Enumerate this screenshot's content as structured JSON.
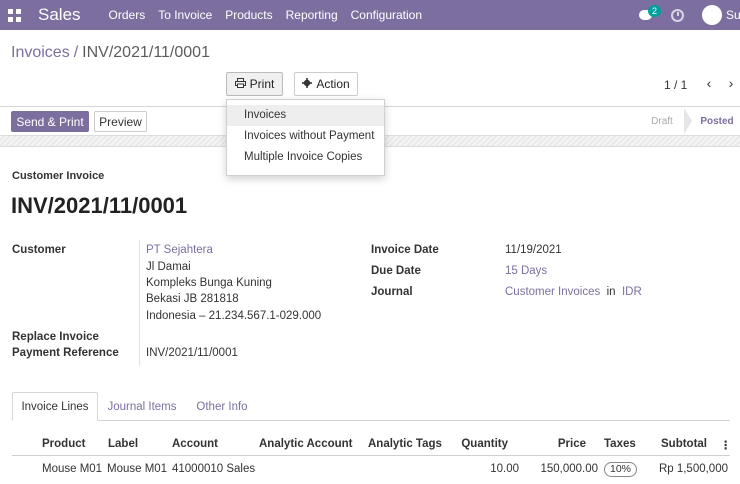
{
  "navbar": {
    "brand": "Sales",
    "menu": [
      "Orders",
      "To Invoice",
      "Products",
      "Reporting",
      "Configuration"
    ],
    "chat_badge": "2",
    "user_name": "Sus"
  },
  "breadcrumb": {
    "parent": "Invoices",
    "separator": "/",
    "current": "INV/2021/11/0001"
  },
  "toolbar": {
    "print_label": "Print",
    "action_label": "Action"
  },
  "pager": {
    "value": "1 / 1",
    "prev": "‹",
    "next": "›"
  },
  "print_menu": {
    "items": [
      "Invoices",
      "Invoices without Payment",
      "Multiple Invoice Copies"
    ]
  },
  "header_buttons": {
    "send_print": "Send & Print",
    "preview": "Preview"
  },
  "statusbar": {
    "draft": "Draft",
    "posted": "Posted"
  },
  "invoice": {
    "type_label": "Customer Invoice",
    "number": "INV/2021/11/0001",
    "customer_label": "Customer",
    "customer_name": "PT Sejahtera",
    "address": [
      "Jl Damai",
      "Kompleks Bunga Kuning",
      "Bekasi JB 281818",
      "Indonesia – 21.234.567.1-029.000"
    ],
    "replace_invoice_label": "Replace Invoice",
    "payment_reference_label": "Payment Reference",
    "payment_reference": "INV/2021/11/0001",
    "invoice_date_label": "Invoice Date",
    "invoice_date": "11/19/2021",
    "due_date_label": "Due Date",
    "due_date": "15 Days",
    "journal_label": "Journal",
    "journal": "Customer Invoices",
    "journal_in": "in",
    "currency": "IDR"
  },
  "tabs": [
    "Invoice Lines",
    "Journal Items",
    "Other Info"
  ],
  "table": {
    "headers": [
      "Product",
      "Label",
      "Account",
      "Analytic Account",
      "Analytic Tags",
      "Quantity",
      "Price",
      "Taxes",
      "Subtotal"
    ],
    "rows": [
      {
        "product": "Mouse M01",
        "label": "Mouse M01",
        "account": "41000010 Sales",
        "quantity": "10.00",
        "price": "150,000.00",
        "tax": "10%",
        "subtotal": "Rp 1,500,000"
      }
    ]
  }
}
